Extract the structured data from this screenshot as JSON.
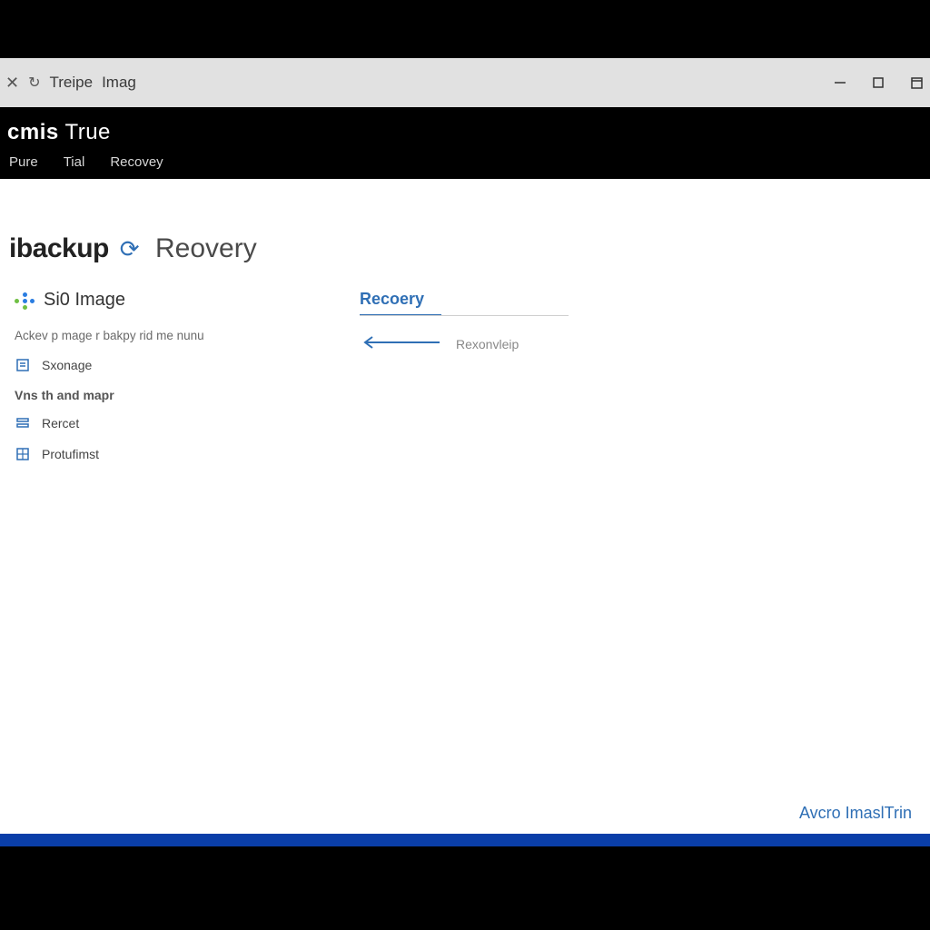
{
  "titlebar": {
    "items": [
      "Treipe",
      "Imag"
    ]
  },
  "brand": {
    "left": "cmis",
    "right": "True"
  },
  "tabs": {
    "items": [
      "Pure",
      "Tial",
      "Recovey"
    ]
  },
  "page": {
    "backup_word": "ibackup",
    "recovery_word": "Reovery"
  },
  "left": {
    "section_title": "Si0 Image",
    "line1": "Ackev p mage r bakpy rid me nunu",
    "item_storage": "Sxonage",
    "sub_heading": "Vns th and mapr",
    "item_recent": "Rercet",
    "item_protect": "Protufimst"
  },
  "right": {
    "heading": "Recoery",
    "row_label": "Rexonvleip"
  },
  "footer": {
    "brand": "Avcro ImaslTrin"
  }
}
